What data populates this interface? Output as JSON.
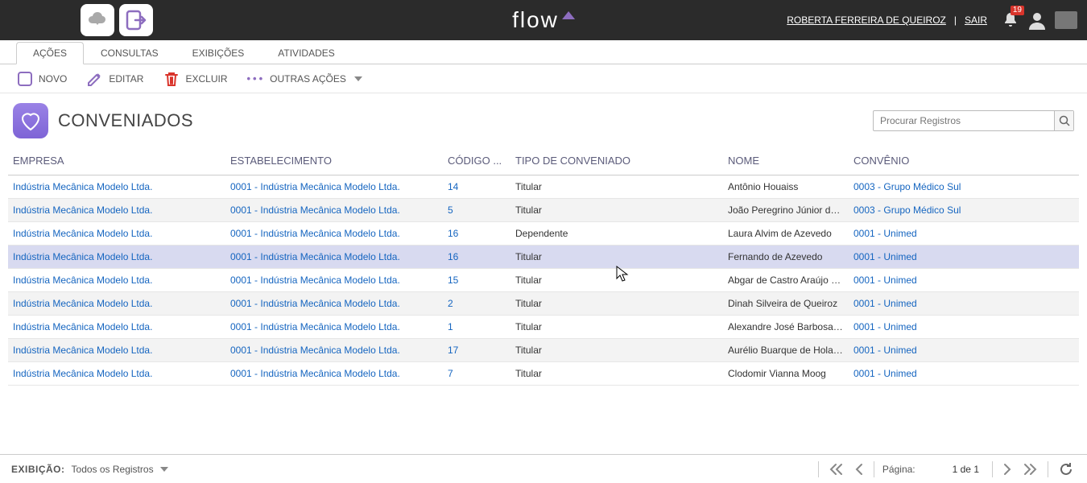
{
  "header": {
    "logo_text": "flow",
    "user_name": "ROBERTA FERREIRA DE QUEIROZ",
    "logout_label": "SAIR",
    "notification_count": "19"
  },
  "tabs": {
    "items": [
      {
        "label": "AÇÕES"
      },
      {
        "label": "CONSULTAS"
      },
      {
        "label": "EXIBIÇÕES"
      },
      {
        "label": "ATIVIDADES"
      }
    ]
  },
  "toolbar": {
    "novo": "NOVO",
    "editar": "EDITAR",
    "excluir": "EXCLUIR",
    "outras": "OUTRAS AÇÕES"
  },
  "page": {
    "title": "CONVENIADOS",
    "search_placeholder": "Procurar Registros"
  },
  "table": {
    "headers": {
      "empresa": "EMPRESA",
      "estabelecimento": "ESTABELECIMENTO",
      "codigo": "CÓDIGO ...",
      "tipo": "TIPO DE CONVENIADO",
      "nome": "NOME",
      "convenio": "CONVÊNIO"
    },
    "rows": [
      {
        "empresa": "Indústria Mecânica Modelo Ltda.",
        "estabelecimento": "0001 - Indústria Mecânica Modelo Ltda.",
        "codigo": "14",
        "tipo": "Titular",
        "nome": "Antônio Houaiss",
        "convenio": "0003 - Grupo Médico Sul"
      },
      {
        "empresa": "Indústria Mecânica Modelo Ltda.",
        "estabelecimento": "0001 - Indústria Mecânica Modelo Ltda.",
        "codigo": "5",
        "tipo": "Titular",
        "nome": "João Peregrino Júnior da Ro...",
        "convenio": "0003 - Grupo Médico Sul"
      },
      {
        "empresa": "Indústria Mecânica Modelo Ltda.",
        "estabelecimento": "0001 - Indústria Mecânica Modelo Ltda.",
        "codigo": "16",
        "tipo": "Dependente",
        "nome": "Laura Alvim de Azevedo",
        "convenio": "0001 - Unimed"
      },
      {
        "empresa": "Indústria Mecânica Modelo Ltda.",
        "estabelecimento": "0001 - Indústria Mecânica Modelo Ltda.",
        "codigo": "16",
        "tipo": "Titular",
        "nome": "Fernando de Azevedo",
        "convenio": "0001 - Unimed"
      },
      {
        "empresa": "Indústria Mecânica Modelo Ltda.",
        "estabelecimento": "0001 - Indústria Mecânica Modelo Ltda.",
        "codigo": "15",
        "tipo": "Titular",
        "nome": "Abgar de Castro Araújo Ren...",
        "convenio": "0001 - Unimed"
      },
      {
        "empresa": "Indústria Mecânica Modelo Ltda.",
        "estabelecimento": "0001 - Indústria Mecânica Modelo Ltda.",
        "codigo": "2",
        "tipo": "Titular",
        "nome": "Dinah Silveira de Queiroz",
        "convenio": "0001 - Unimed"
      },
      {
        "empresa": "Indústria Mecânica Modelo Ltda.",
        "estabelecimento": "0001 - Indústria Mecânica Modelo Ltda.",
        "codigo": "1",
        "tipo": "Titular",
        "nome": "Alexandre José Barbosa Lim...",
        "convenio": "0001 - Unimed"
      },
      {
        "empresa": "Indústria Mecânica Modelo Ltda.",
        "estabelecimento": "0001 - Indústria Mecânica Modelo Ltda.",
        "codigo": "17",
        "tipo": "Titular",
        "nome": "Aurélio Buarque de Holanda...",
        "convenio": "0001 - Unimed"
      },
      {
        "empresa": "Indústria Mecânica Modelo Ltda.",
        "estabelecimento": "0001 - Indústria Mecânica Modelo Ltda.",
        "codigo": "7",
        "tipo": "Titular",
        "nome": "Clodomir Vianna Moog",
        "convenio": "0001 - Unimed"
      }
    ]
  },
  "footer": {
    "exibicao_label": "EXIBIÇÃO:",
    "exibicao_value": "Todos os Registros",
    "pagina_label": "Página:",
    "pagina_value": "1 de 1"
  }
}
